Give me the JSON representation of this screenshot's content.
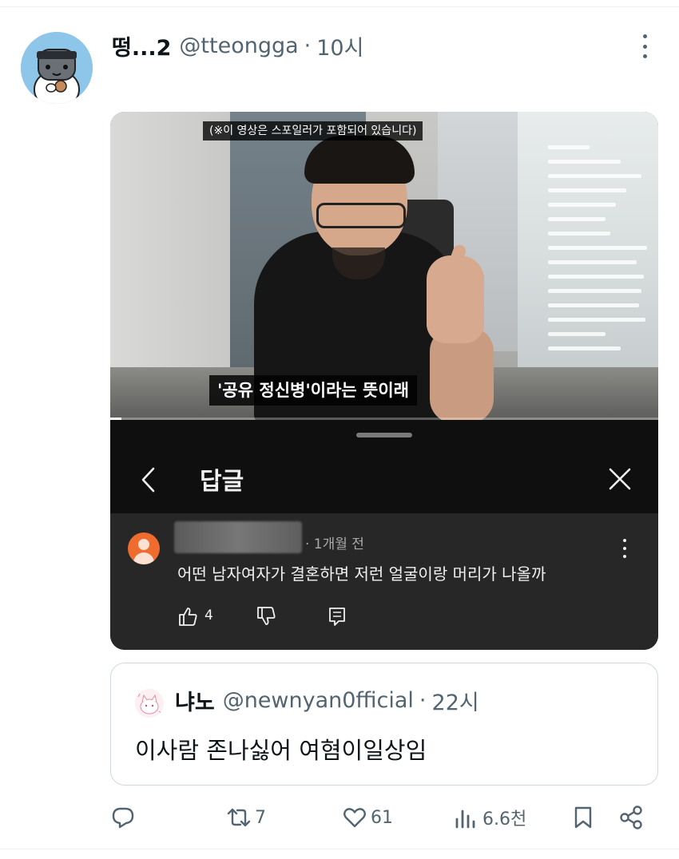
{
  "tweet": {
    "display_name": "떵...2",
    "handle": "@tteongga",
    "separator": "·",
    "time": "10시"
  },
  "video": {
    "spoiler_notice": "(※이 영상은 스포일러가 포함되어 있습니다)",
    "subtitle": "'공유 정신병'이라는 뜻이래",
    "progress": 0.02
  },
  "reply_panel": {
    "title": "답글",
    "comment": {
      "meta": "· 1개월 전",
      "text": "어떤 남자여자가 결혼하면 저런 얼굴이랑 머리가 나올까",
      "like_count": "4"
    }
  },
  "quote": {
    "display_name": "냐노",
    "handle": "@newnyan0fficial",
    "separator": "·",
    "time": "22시",
    "text": "이사람 존나싫어 여혐이일상임"
  },
  "actions": {
    "reply": "",
    "retweet_count": "7",
    "like_count": "61",
    "views_count": "6.6천"
  },
  "colors": {
    "text": "#0f1419",
    "secondary": "#536471",
    "avatar_bg": "#8ec6ea",
    "comment_avatar": "#ef6c2e",
    "panel_dark": "#0f0f0f",
    "comment_bg": "#272727"
  },
  "icons": [
    "more-vertical-icon",
    "chevron-left-icon",
    "close-icon",
    "thumbs-up-icon",
    "thumbs-down-icon",
    "comment-reply-icon",
    "reply-icon",
    "retweet-icon",
    "heart-icon",
    "views-icon",
    "bookmark-icon",
    "share-icon"
  ]
}
